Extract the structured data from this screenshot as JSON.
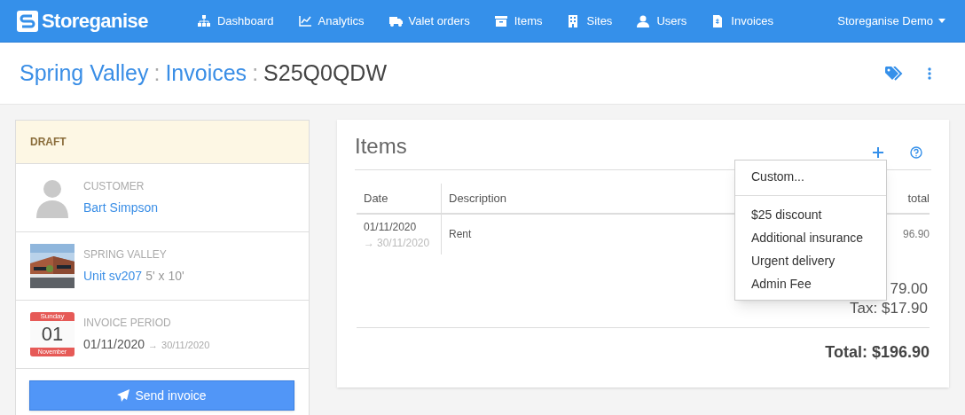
{
  "nav": {
    "brand": "Storeganise",
    "items": [
      {
        "label": "Dashboard"
      },
      {
        "label": "Analytics"
      },
      {
        "label": "Valet orders"
      },
      {
        "label": "Items"
      },
      {
        "label": "Sites"
      },
      {
        "label": "Users"
      },
      {
        "label": "Invoices"
      }
    ],
    "account": "Storeganise Demo"
  },
  "breadcrumb": [
    {
      "label": "Spring Valley",
      "kind": "link",
      "separator": ":"
    },
    {
      "label": "Invoices",
      "kind": "link",
      "separator": ":"
    },
    {
      "label": "S25Q0QDW",
      "kind": "current"
    }
  ],
  "status": {
    "label": "DRAFT"
  },
  "customer": {
    "label": "CUSTOMER",
    "name": "Bart Simpson"
  },
  "site": {
    "label": "SPRING VALLEY",
    "unit": "Unit sv207",
    "size": "5' x 10'"
  },
  "period": {
    "calendar": {
      "weekday": "Sunday",
      "day": "01",
      "month": "November"
    },
    "label": "INVOICE PERIOD",
    "start": "01/11/2020",
    "arrow": "→",
    "end": "30/11/2020"
  },
  "send_button": {
    "label": "Send invoice"
  },
  "items_panel": {
    "title": "Items",
    "columns": [
      "Date",
      "Description",
      "total"
    ],
    "rows": [
      {
        "start": "01/11/2020",
        "arrow": "→",
        "end": "30/11/2020",
        "description": "Rent",
        "amount": "96.90"
      }
    ],
    "subtotal": "79.00",
    "tax": "Tax: $17.90",
    "total": "Total: $196.90"
  },
  "add_menu": {
    "groups": [
      [
        "Custom..."
      ],
      [
        "$25 discount",
        "Additional insurance",
        "Urgent delivery",
        "Admin Fee"
      ]
    ]
  }
}
